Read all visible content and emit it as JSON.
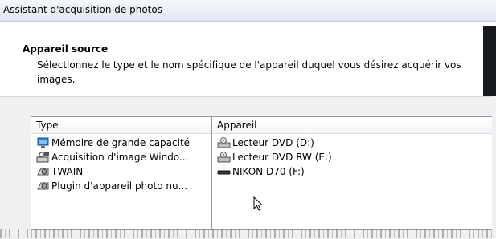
{
  "window": {
    "title": "Assistant d'acquisition de photos"
  },
  "header": {
    "title": "Appareil source",
    "description": "Sélectionnez le type et le nom spécifique de l'appareil duquel vous désirez acquérir vos images."
  },
  "type_list": {
    "header": "Type",
    "items": [
      {
        "label": "Mémoire de grande capacité",
        "icon": "monitor-icon"
      },
      {
        "label": "Acquisition d'image Windo...",
        "icon": "scanner-camera-icon"
      },
      {
        "label": "TWAIN",
        "icon": "camera-icon"
      },
      {
        "label": "Plugin d'appareil photo nu...",
        "icon": "camera-icon"
      }
    ]
  },
  "device_list": {
    "header": "Appareil",
    "items": [
      {
        "label": "Lecteur DVD (D:)",
        "icon": "dvd-drive-icon"
      },
      {
        "label": "Lecteur DVD RW (E:)",
        "icon": "dvd-drive-icon"
      },
      {
        "label": "NIKON D70 (F:)",
        "icon": "removable-drive-icon"
      }
    ]
  }
}
